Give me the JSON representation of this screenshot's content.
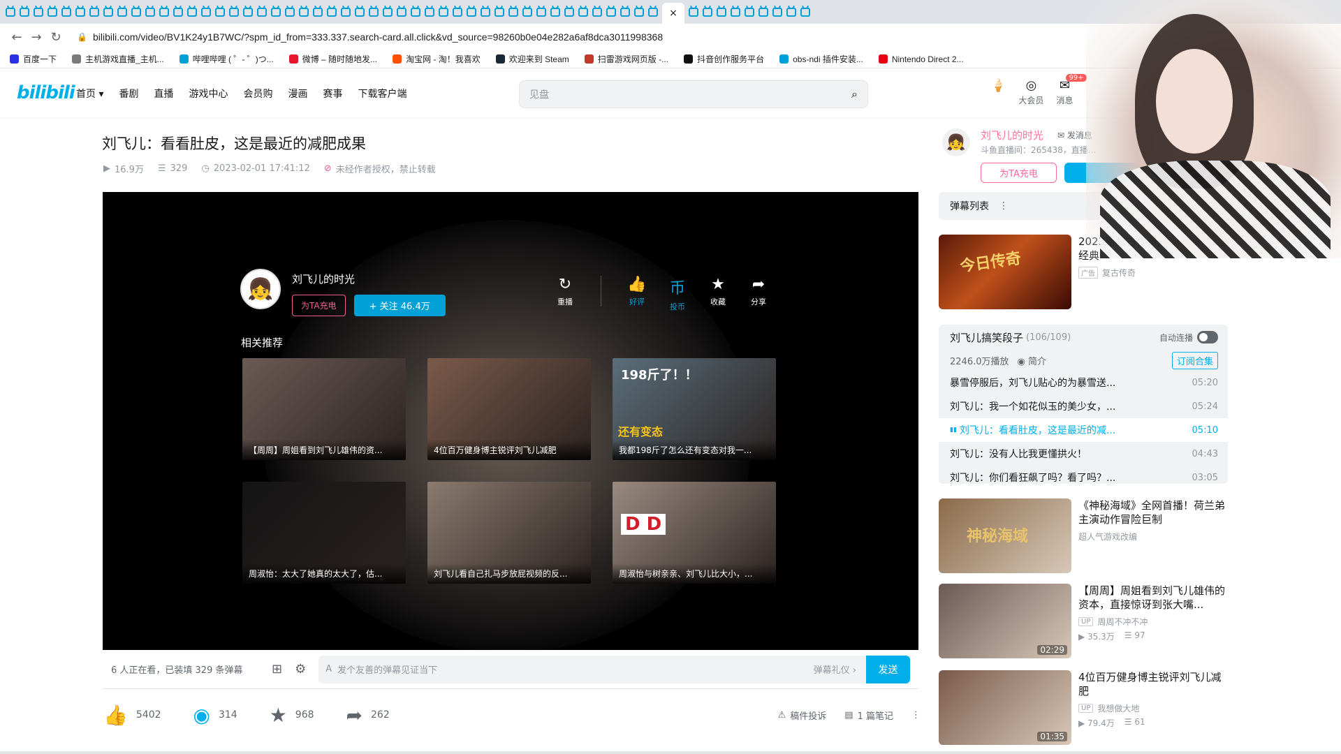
{
  "browser": {
    "url": "bilibili.com/video/BV1K24y1B7WC/?spm_id_from=333.337.search-card.all.click&vd_source=98260b0e04e282a6af8dca3011998368",
    "bookmarks": [
      {
        "label": "百度一下",
        "color": "#2932e1"
      },
      {
        "label": "主机游戏直播_主机...",
        "color": "#7a7a7a"
      },
      {
        "label": "哔哩哔哩 ( ゜- ゜)つ...",
        "color": "#00a1d6"
      },
      {
        "label": "微博 – 随时随地发...",
        "color": "#e6162d"
      },
      {
        "label": "淘宝网 - 淘！我喜欢",
        "color": "#ff5000"
      },
      {
        "label": "欢迎来到 Steam",
        "color": "#1b2838"
      },
      {
        "label": "扫雷游戏网页版 -...",
        "color": "#c0392b"
      },
      {
        "label": "抖音创作服务平台",
        "color": "#111111"
      },
      {
        "label": "obs-ndi 插件安装...",
        "color": "#00a1d6"
      },
      {
        "label": "Nintendo Direct 2...",
        "color": "#e60012"
      }
    ]
  },
  "header": {
    "logo": "bilibili",
    "nav": [
      "首页 ▾",
      "番剧",
      "直播",
      "游戏中心",
      "会员购",
      "漫画",
      "赛事",
      "下载客户端"
    ],
    "search_placeholder": "见盘",
    "right": [
      {
        "icon": "ice-cream-icon",
        "label": ""
      },
      {
        "icon": "vip-icon",
        "label": "大会员"
      },
      {
        "icon": "message-icon",
        "label": "消息",
        "badge": "99+"
      }
    ]
  },
  "video": {
    "title": "刘飞儿：看看肚皮，这是最近的减肥成果",
    "views": "16.9万",
    "danmaku_count": "329",
    "datetime": "2023-02-01 17:41:12",
    "copyright": "未经作者授权，禁止转载"
  },
  "player": {
    "up_name": "刘飞儿的时光",
    "charge_label": "为TA充电",
    "follow_label": "+ 关注 46.4万",
    "actions": [
      {
        "name": "replay",
        "label": "重播",
        "glyph": "↻",
        "blue": false
      },
      {
        "name": "like",
        "label": "好评",
        "glyph": "👍",
        "blue": true
      },
      {
        "name": "coin",
        "label": "投币",
        "glyph": "币",
        "blue": true
      },
      {
        "name": "favorite",
        "label": "收藏",
        "glyph": "★",
        "blue": false
      },
      {
        "name": "share",
        "label": "分享",
        "glyph": "➦",
        "blue": false
      }
    ],
    "related_title": "相关推荐",
    "related": [
      {
        "caption": "【周周】周姐看到刘飞儿雄伟的资...",
        "overlay": "",
        "bg": "#6b5a55"
      },
      {
        "caption": "4位百万健身博主锐评刘飞儿减肥",
        "overlay": "",
        "bg": "#7a5a4a"
      },
      {
        "caption": "我都198斤了怎么还有变态对我一...",
        "overlay": "198斤了！！",
        "overlay2": "还有变态",
        "bg": "#5a6e7a"
      },
      {
        "caption": "周淑怡：太大了她真的太大了，估...",
        "overlay": "",
        "bg": "#141414"
      },
      {
        "caption": "刘飞儿看自己扎马步放屁视频的反...",
        "overlay": "",
        "bg": "#8a7a6e"
      },
      {
        "caption": "周淑怡与树亲亲、刘飞儿比大小，...",
        "overlay": "D  D",
        "bg": "#9a8a80"
      }
    ]
  },
  "danmaku_bar": {
    "status": "6 人正在看，已装填 329 条弹幕",
    "placeholder": "发个友善的弹幕见证当下",
    "etiquette": "弹幕礼仪 ›",
    "send": "发送"
  },
  "toolbar": {
    "like": "5402",
    "coin": "314",
    "fav": "968",
    "share": "262",
    "report": "稿件投诉",
    "notes": "1 篇笔记"
  },
  "sidebar": {
    "up": {
      "name": "刘飞儿的时光",
      "message": "发消息",
      "desc": "斗鱼直播间：265438，直播...",
      "charge": "为TA充电"
    },
    "danmaku_list": "弹幕列表",
    "ad": {
      "title": "2023新复古传奇,原汁原味重温经典",
      "tag": "广告",
      "source": "复古传奇"
    },
    "playlist": {
      "title": "刘飞儿搞笑段子",
      "count": "(106/109)",
      "autoplay": "自动连播",
      "plays": "2246.0万播放",
      "intro": "简介",
      "subscribe": "订阅合集",
      "items": [
        {
          "title": "暴雪停服后，刘飞儿贴心的为暴雪送...",
          "dur": "05:20",
          "active": false
        },
        {
          "title": "刘飞儿：我一个如花似玉的美少女，...",
          "dur": "05:24",
          "active": false
        },
        {
          "title": "刘飞儿：看看肚皮，这是最近的减...",
          "dur": "05:10",
          "active": true
        },
        {
          "title": "刘飞儿：没有人比我更懂拱火！",
          "dur": "04:43",
          "active": false
        },
        {
          "title": "刘飞儿：你们看狂飙了吗？看了吗？...",
          "dur": "03:05",
          "active": false
        }
      ]
    },
    "recommend": [
      {
        "title": "《神秘海域》全网首播！荷兰弟主演动作冒险巨制",
        "up": "超人气游戏改编",
        "views": "",
        "danmaku": "",
        "dur": "",
        "thumb_text": "神秘海域",
        "bg": "#8a6a4a"
      },
      {
        "title": "【周周】周姐看到刘飞儿雄伟的资本，直接惊讶到张大嘴...",
        "up": "周周不冲不冲",
        "views": "35.3万",
        "danmaku": "97",
        "dur": "02:29",
        "thumb_text": "",
        "bg": "#6b5a55"
      },
      {
        "title": "4位百万健身博主锐评刘飞儿减肥",
        "up": "我想做大地",
        "views": "79.4万",
        "danmaku": "61",
        "dur": "01:35",
        "thumb_text": "",
        "bg": "#7a5a4a"
      }
    ]
  }
}
